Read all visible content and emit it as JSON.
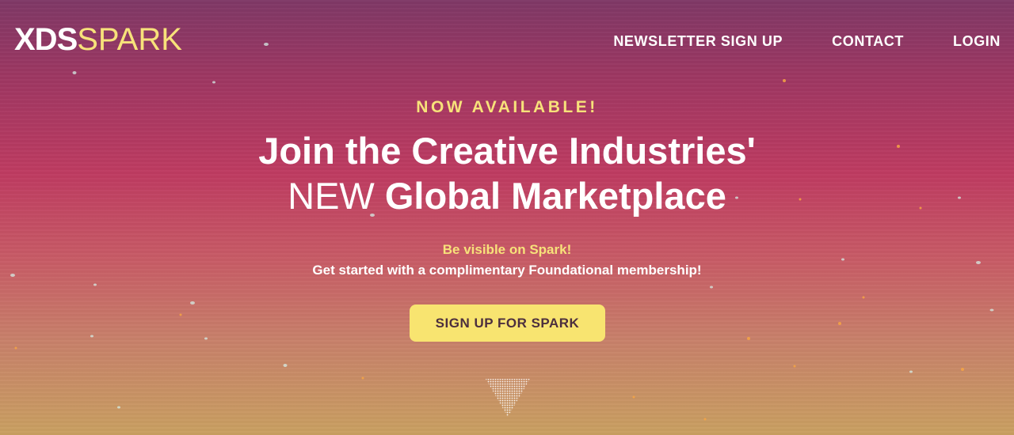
{
  "brand": {
    "logo_bold": "XDS",
    "logo_light": "SPARK",
    "accent": "#f7e27a"
  },
  "nav": {
    "items": [
      {
        "label": "NEWSLETTER SIGN UP",
        "name": "nav-newsletter-signup"
      },
      {
        "label": "CONTACT",
        "name": "nav-contact"
      },
      {
        "label": "LOGIN",
        "name": "nav-login"
      }
    ]
  },
  "hero": {
    "eyebrow": "NOW AVAILABLE!",
    "headline_line1": "Join the Creative Industries'",
    "headline_line2_light": "NEW",
    "headline_line2_bold": "Global Marketplace",
    "sub_highlight": "Be visible on Spark!",
    "sub_text": "Get started with a complimentary Foundational membership!",
    "cta_label": "SIGN UP FOR SPARK",
    "cta_color": "#f8e470",
    "scroll_icon": "chevron-down-icon"
  }
}
